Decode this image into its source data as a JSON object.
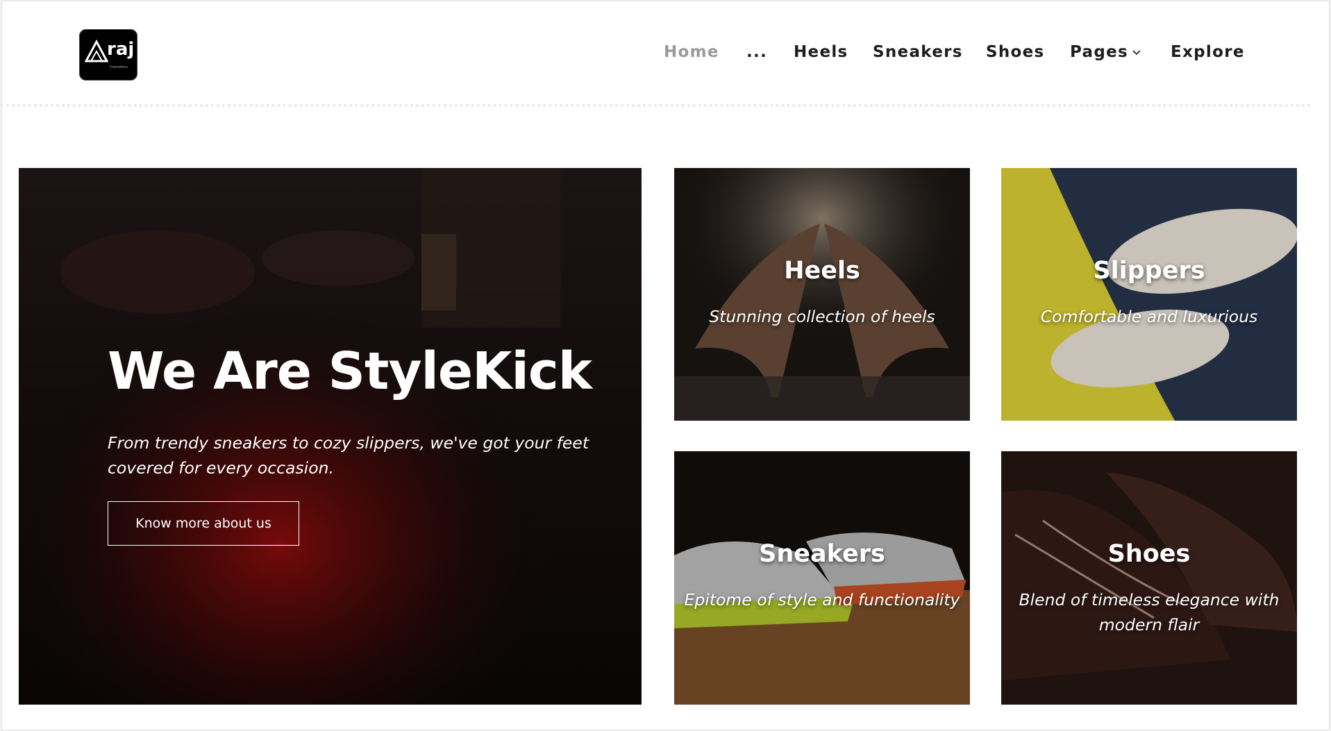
{
  "brand": {
    "logo_text": "raj",
    "logo_sub": "Cosmetics"
  },
  "nav": {
    "items": [
      {
        "label": "Home"
      },
      {
        "label": "..."
      },
      {
        "label": "Heels"
      },
      {
        "label": "Sneakers"
      },
      {
        "label": "Shoes"
      },
      {
        "label": "Pages"
      },
      {
        "label": "Explore"
      }
    ],
    "active_item": "Home",
    "active_color": "#9a9a9a",
    "text_color": "#1d1d1d"
  },
  "hero": {
    "title": "We Are StyleKick",
    "subtitle": "From trendy sneakers to cozy slippers, we've got your feet covered for every occasion.",
    "button_label": "Know more about us"
  },
  "categories": [
    {
      "title": "Heels",
      "subtitle": "Stunning collection of heels"
    },
    {
      "title": "Slippers",
      "subtitle": "Comfortable and luxurious"
    },
    {
      "title": "Sneakers",
      "subtitle": "Epitome of style and functionality"
    },
    {
      "title": "Shoes",
      "subtitle": "Blend of timeless elegance with modern flair"
    }
  ],
  "icons": {
    "pages_dropdown": "chevron-down-icon"
  }
}
